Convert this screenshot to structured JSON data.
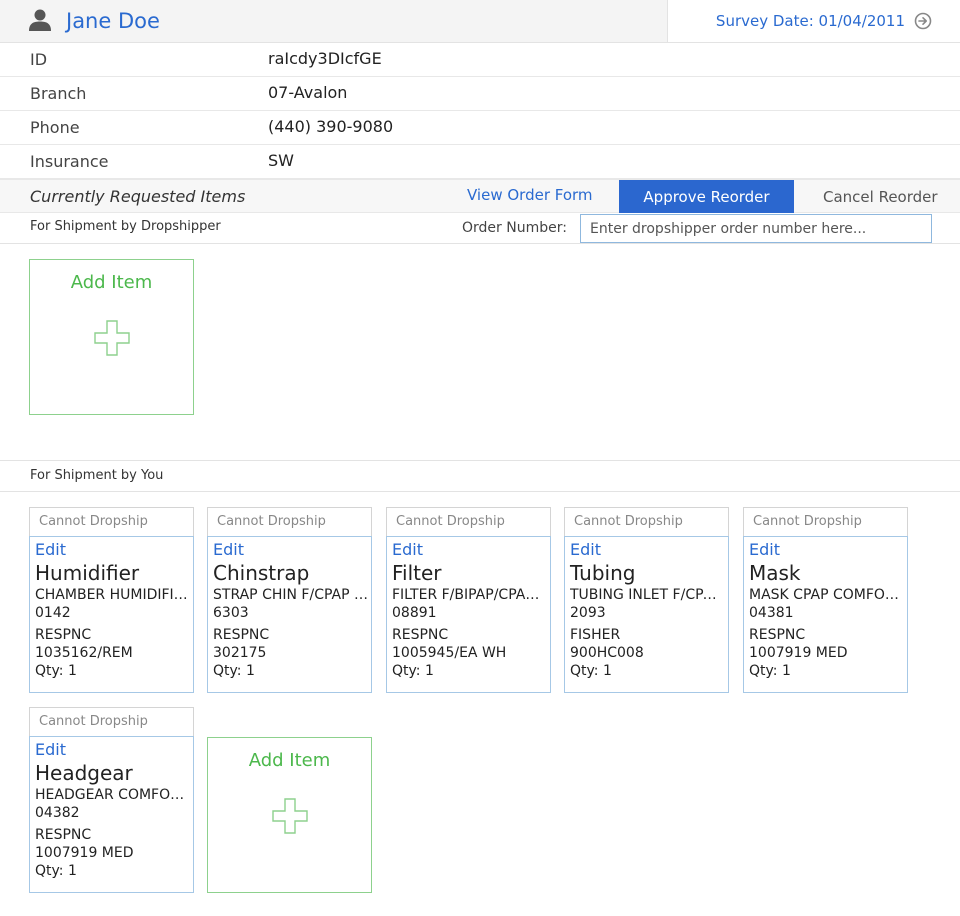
{
  "header": {
    "user_name": "Jane Doe",
    "survey_date": "Survey Date: 01/04/2011"
  },
  "info": [
    {
      "label": "ID",
      "value": "raIcdy3DIcfGE"
    },
    {
      "label": "Branch",
      "value": "07-Avalon"
    },
    {
      "label": "Phone",
      "value": "(440) 390-9080"
    },
    {
      "label": "Insurance",
      "value": "SW"
    }
  ],
  "requested": {
    "title": "Currently Requested Items",
    "view_order_form": "View Order Form",
    "approve_reorder": "Approve Reorder",
    "cancel_reorder": "Cancel Reorder"
  },
  "dropship": {
    "label": "For Shipment by Dropshipper",
    "order_number_label": "Order Number:",
    "order_number_placeholder": "Enter dropshipper order number here...",
    "add_item": "Add Item"
  },
  "you": {
    "label": "For Shipment by You",
    "add_item": "Add Item",
    "items": [
      {
        "tag": "Cannot Dropship",
        "edit": "Edit",
        "name": "Humidifier",
        "desc": "CHAMBER HUMIDIFIER F/CPAP",
        "code": "0142",
        "vendor": "RESPNC",
        "part": "1035162/REM",
        "qty": "Qty: 1"
      },
      {
        "tag": "Cannot Dropship",
        "edit": "Edit",
        "name": "Chinstrap",
        "desc": "STRAP CHIN F/CPAP MASK",
        "code": "6303",
        "vendor": "RESPNC",
        "part": "302175",
        "qty": "Qty: 1"
      },
      {
        "tag": "Cannot Dropship",
        "edit": "Edit",
        "name": "Filter",
        "desc": "FILTER F/BIPAP/CPAP UNIT",
        "code": "08891",
        "vendor": "RESPNC",
        "part": "1005945/EA WH",
        "qty": "Qty: 1"
      },
      {
        "tag": "Cannot Dropship",
        "edit": "Edit",
        "name": "Tubing",
        "desc": "TUBING INLET F/CPAP UNIT",
        "code": "2093",
        "vendor": "FISHER",
        "part": "900HC008",
        "qty": "Qty: 1"
      },
      {
        "tag": "Cannot Dropship",
        "edit": "Edit",
        "name": "Mask",
        "desc": "MASK CPAP COMFORTGEL",
        "code": "04381",
        "vendor": "RESPNC",
        "part": "1007919 MED",
        "qty": "Qty: 1"
      },
      {
        "tag": "Cannot Dropship",
        "edit": "Edit",
        "name": "Headgear",
        "desc": "HEADGEAR COMFORTGEL",
        "code": "04382",
        "vendor": "RESPNC",
        "part": "1007919 MED",
        "qty": "Qty: 1"
      }
    ]
  },
  "colors": {
    "accent": "#2b67cf",
    "add_green": "#4cb84c",
    "card_border": "#a6c8e6"
  }
}
